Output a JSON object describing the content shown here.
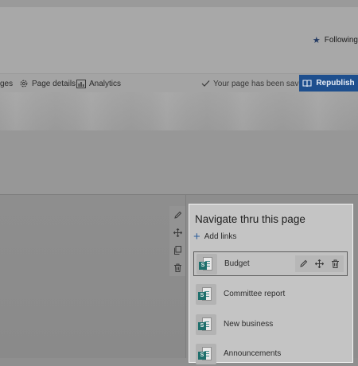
{
  "header": {
    "following_label": "Following"
  },
  "command_bar": {
    "pages_label": "ges",
    "page_details_label": "Page details",
    "analytics_label": "Analytics",
    "saved_status": "Your page has been saved",
    "republish_label": "Republish"
  },
  "panel": {
    "title": "Navigate thru this page",
    "add_links_label": "Add links",
    "items": [
      {
        "label": "Budget",
        "selected": true
      },
      {
        "label": "Committee report"
      },
      {
        "label": "New business"
      },
      {
        "label": "Announcements"
      }
    ]
  },
  "icons": {
    "following": "star-icon",
    "page_details": "gear-icon",
    "analytics": "analytics-icon",
    "saved": "checkmark-icon",
    "republish": "book-icon",
    "edit": "pencil-icon",
    "move": "move-icon",
    "duplicate": "copy-icon",
    "delete": "trash-icon",
    "add": "plus-icon",
    "item": "sharepoint-page-icon"
  },
  "colors": {
    "accent": "#1e4f8e",
    "badge": "#1f6f6c"
  }
}
